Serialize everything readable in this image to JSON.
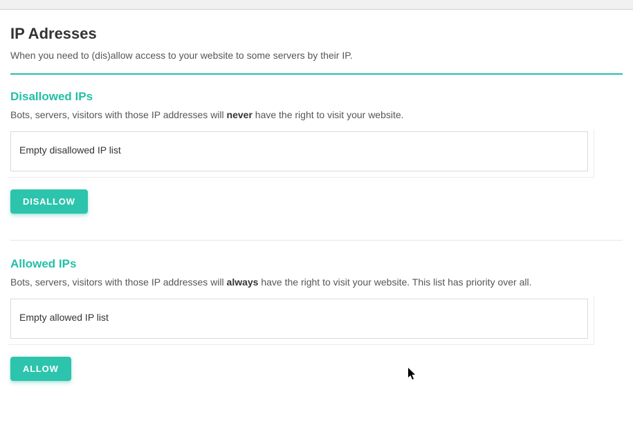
{
  "page": {
    "title": "IP Adresses",
    "description": "When you need to (dis)allow access to your website to some servers by their IP."
  },
  "disallowed": {
    "title": "Disallowed IPs",
    "desc_pre": "Bots, servers, visitors with those IP addresses will ",
    "desc_bold": "never",
    "desc_post": " have the right to visit your website.",
    "list_text": "Empty disallowed IP list",
    "button_label": "DISALLOW"
  },
  "allowed": {
    "title": "Allowed IPs",
    "desc_pre": "Bots, servers, visitors with those IP addresses will ",
    "desc_bold": "always",
    "desc_post": " have the right to visit your website. This list has priority over all.",
    "list_text": "Empty allowed IP list",
    "button_label": "ALLOW"
  }
}
